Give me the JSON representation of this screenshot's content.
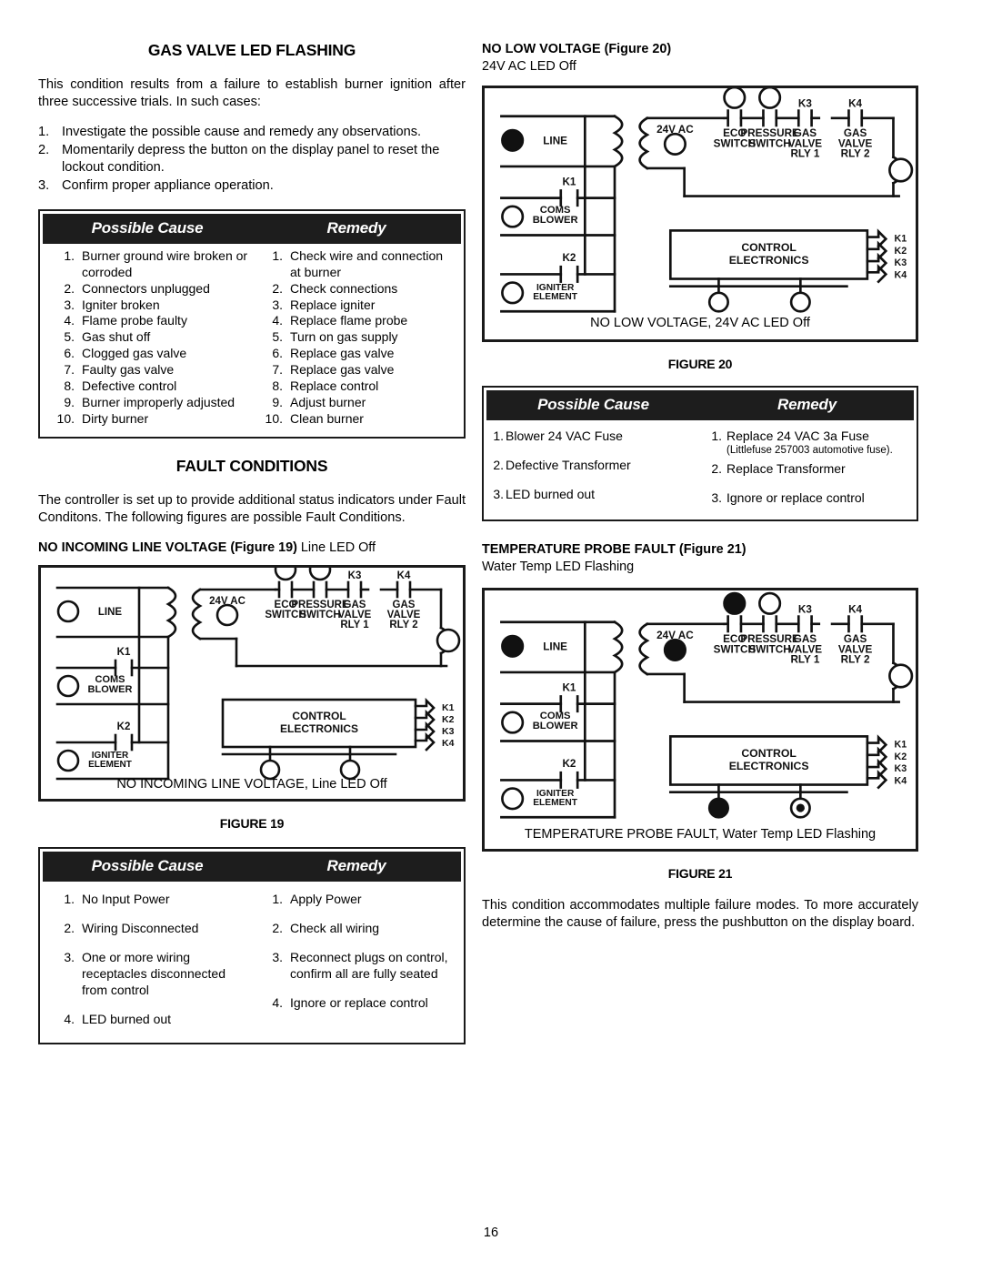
{
  "page": {
    "number": "16"
  },
  "left_column": {
    "heading": "GAS VALVE LED FLASHING",
    "intro": "This condition results from a failure to establish burner ignition after three successive trials. In such cases:",
    "steps": [
      {
        "num": "1.",
        "text": "Investigate the possible cause and remedy any observations."
      },
      {
        "num": "2.",
        "text": "Momentarily depress the button on the display panel to reset the lockout condition."
      },
      {
        "num": "3.",
        "text": "Confirm proper appliance operation."
      }
    ],
    "table_gas_valve": {
      "header_cause": "Possible Cause",
      "header_remedy": "Remedy",
      "causes": [
        {
          "num": "1.",
          "text": "Burner ground wire broken or corroded"
        },
        {
          "num": "2.",
          "text": "Connectors unplugged"
        },
        {
          "num": "3.",
          "text": "Igniter broken"
        },
        {
          "num": "4.",
          "text": "Flame probe faulty"
        },
        {
          "num": "5.",
          "text": "Gas shut off"
        },
        {
          "num": "6.",
          "text": "Clogged gas valve"
        },
        {
          "num": "7.",
          "text": "Faulty gas valve"
        },
        {
          "num": "8.",
          "text": "Defective control"
        },
        {
          "num": "9.",
          "text": "Burner improperly adjusted"
        },
        {
          "num": "10.",
          "text": "Dirty burner"
        }
      ],
      "remedies": [
        {
          "num": "1.",
          "text": "Check wire and connection at burner"
        },
        {
          "num": "2.",
          "text": "Check connections"
        },
        {
          "num": "3.",
          "text": "Replace igniter"
        },
        {
          "num": "4.",
          "text": "Replace flame probe"
        },
        {
          "num": "5.",
          "text": "Turn on gas supply"
        },
        {
          "num": "6.",
          "text": "Replace gas valve"
        },
        {
          "num": "7.",
          "text": "Replace gas valve"
        },
        {
          "num": "8.",
          "text": "Replace control"
        },
        {
          "num": "9.",
          "text": "Adjust burner"
        },
        {
          "num": "10.",
          "text": "Clean burner"
        }
      ]
    },
    "fault_heading": "FAULT CONDITIONS",
    "fault_intro": "The controller is set up to provide additional status indicators under Fault Conditons. The following figures are possible Fault Conditions.",
    "figure19": {
      "title_bold": "NO INCOMING LINE VOLTAGE (Figure 19)",
      "title_light": "Line LED Off",
      "caption": "NO INCOMING LINE VOLTAGE, Line LED Off",
      "label": "FIGURE 19",
      "labels": {
        "line": "LINE",
        "k1": "K1",
        "k2": "K2",
        "coms_blower_1": "COMS",
        "coms_blower_2": "BLOWER",
        "igniter_1": "IGNITER",
        "igniter_2": "ELEMENT",
        "transformer": "24V AC",
        "eco_1": "ECO",
        "eco_2": "SWITCH",
        "pressure_1": "PRESSURE",
        "pressure_2": "SWITCH",
        "k3": "K3",
        "k4": "K4",
        "gas_valve_1_a": "GAS",
        "gas_valve_1_b": "VALVE",
        "gas_valve_1_c": "RLY 1",
        "gas_valve_2_a": "GAS",
        "gas_valve_2_b": "VALVE",
        "gas_valve_2_c": "RLY 2",
        "control_1": "CONTROL",
        "control_2": "ELECTRONICS",
        "relay_k1": "K1",
        "relay_k2": "K2",
        "relay_k3": "K3",
        "relay_k4": "K4"
      },
      "led_states": {
        "line": "off",
        "coms_blower": "off",
        "igniter_element": "off",
        "transformer_24vac": "off",
        "eco_switch": "off",
        "pressure_switch": "off",
        "gas_valve": "off",
        "bottom_left": "off",
        "bottom_right": "off"
      }
    },
    "table_figure19": {
      "header_cause": "Possible Cause",
      "header_remedy": "Remedy",
      "causes": [
        {
          "num": "1.",
          "text": "No Input Power"
        },
        {
          "num": "2.",
          "text": "Wiring Disconnected"
        },
        {
          "num": "3.",
          "text": "One or more wiring receptacles disconnected from control"
        },
        {
          "num": "4.",
          "text": "LED burned out"
        }
      ],
      "remedies": [
        {
          "num": "1.",
          "text": "Apply Power"
        },
        {
          "num": "2.",
          "text": "Check all wiring"
        },
        {
          "num": "3.",
          "text": "Reconnect plugs on control, confirm all are fully seated"
        },
        {
          "num": "4.",
          "text": "Ignore or replace control"
        }
      ]
    }
  },
  "right_column": {
    "figure20": {
      "title_bold": "NO LOW VOLTAGE (Figure 20)",
      "title_light": "24V AC LED Off",
      "caption": "NO LOW VOLTAGE, 24V AC LED Off",
      "label": "FIGURE 20",
      "led_states": {
        "line": "on",
        "coms_blower": "off",
        "igniter_element": "off",
        "transformer_24vac": "off",
        "eco_switch": "off",
        "pressure_switch": "off",
        "gas_valve": "off",
        "bottom_left": "off",
        "bottom_right": "off"
      }
    },
    "table_figure20": {
      "header_cause": "Possible Cause",
      "header_remedy": "Remedy",
      "causes": [
        {
          "num": "1.",
          "text": "Blower 24 VAC Fuse"
        },
        {
          "num": "2.",
          "text": "Defective Transformer"
        },
        {
          "num": "3.",
          "text": "LED burned out"
        }
      ],
      "remedies": [
        {
          "num": "1.",
          "text": "Replace 24 VAC 3a Fuse",
          "note": "(Littlefuse 257003 automotive fuse)."
        },
        {
          "num": "2.",
          "text": "Replace Transformer"
        },
        {
          "num": "3.",
          "text": "Ignore or replace control"
        }
      ]
    },
    "figure21": {
      "title_bold": "TEMPERATURE PROBE FAULT (Figure 21)",
      "title_light": "Water Temp LED Flashing",
      "caption": "TEMPERATURE PROBE FAULT, Water Temp LED Flashing",
      "label": "FIGURE 21",
      "led_states": {
        "line": "on",
        "coms_blower": "off",
        "igniter_element": "off",
        "transformer_24vac": "on",
        "eco_switch": "on",
        "pressure_switch": "off",
        "gas_valve": "off",
        "bottom_left": "on",
        "bottom_right": "flashing"
      }
    },
    "closing_paragraph": "This condition accommodates multiple failure modes. To more accurately determine the cause of failure, press the pushbutton on the display board."
  }
}
